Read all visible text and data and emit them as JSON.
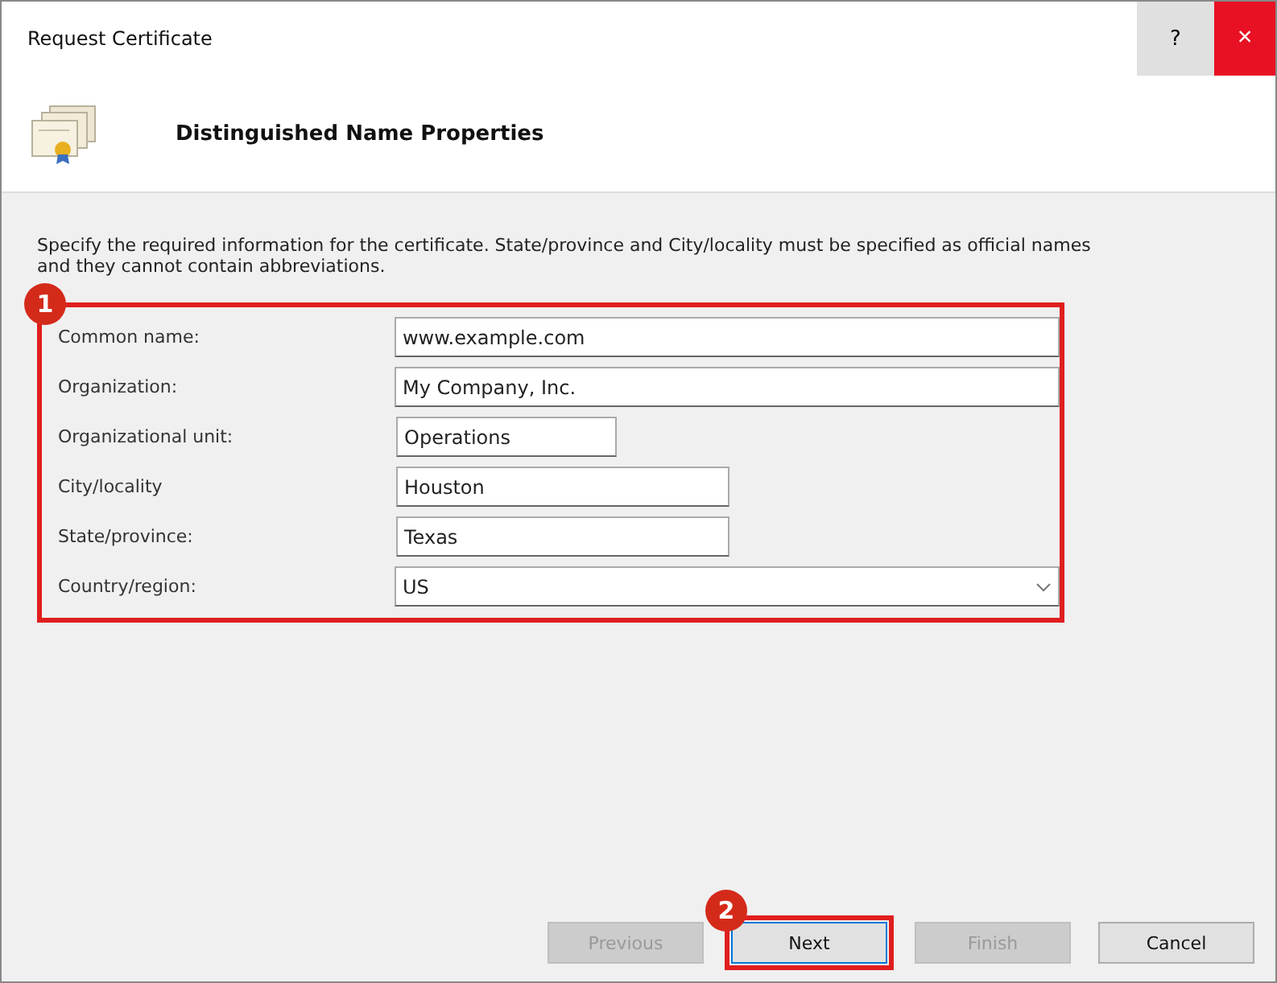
{
  "window": {
    "title": "Request Certificate",
    "help": "?",
    "close": "×"
  },
  "header": {
    "title": "Distinguished Name Properties"
  },
  "instructions": "Specify the required information for the certificate. State/province and City/locality must be specified as official names and they cannot contain abbreviations.",
  "form": {
    "callout": "1",
    "fields": [
      {
        "label": "Common name:",
        "value": "www.example.com",
        "kind": "text"
      },
      {
        "label": "Organization:",
        "value": "My Company, Inc.",
        "kind": "text"
      },
      {
        "label": "Organizational unit:",
        "value": "Operations",
        "kind": "text"
      },
      {
        "label": "City/locality",
        "value": "Houston",
        "kind": "text"
      },
      {
        "label": "State/province:",
        "value": "Texas",
        "kind": "text"
      },
      {
        "label": "Country/region:",
        "value": "US",
        "kind": "dropdown"
      }
    ]
  },
  "buttons": [
    {
      "label": "Previous",
      "disabled": true
    },
    {
      "label": "Next",
      "disabled": false,
      "callout": "2"
    },
    {
      "label": "Finish",
      "disabled": true
    },
    {
      "label": "Cancel",
      "disabled": false
    }
  ]
}
